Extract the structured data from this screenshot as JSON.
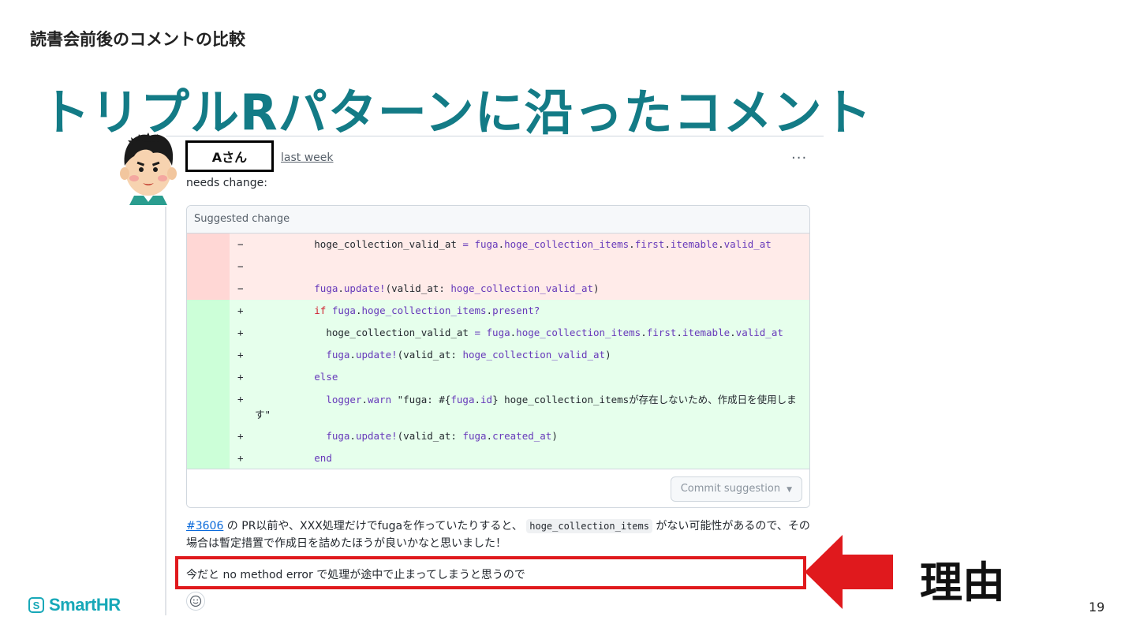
{
  "slide": {
    "subtitle": "読書会前後のコメントの比較",
    "title": "トリプルRパターンに沿ったコメント",
    "page_number": "19",
    "logo_text": "SmartHR",
    "logo_mark": "S",
    "reason_label": "理由",
    "accent_color": "#137b86",
    "highlight_color": "#e0191d"
  },
  "comment": {
    "author": "Aさん",
    "timestamp": "last week",
    "more_label": "···",
    "label": "needs change:",
    "suggestion": {
      "header": "Suggested change",
      "deleted": [
        {
          "marker": "−",
          "indent": "          ",
          "parts": [
            [
              "t",
              "hoge_collection_valid_at "
            ],
            [
              "m",
              "="
            ],
            [
              "t",
              " "
            ],
            [
              "m",
              "fuga"
            ],
            [
              "t",
              "."
            ],
            [
              "m",
              "hoge_collection_items"
            ],
            [
              "t",
              "."
            ],
            [
              "m",
              "first"
            ],
            [
              "t",
              "."
            ],
            [
              "m",
              "itemable"
            ],
            [
              "t",
              "."
            ],
            [
              "m",
              "valid_at"
            ]
          ]
        },
        {
          "marker": "−",
          "indent": "",
          "parts": []
        },
        {
          "marker": "−",
          "indent": "          ",
          "parts": [
            [
              "m",
              "fuga"
            ],
            [
              "t",
              "."
            ],
            [
              "m",
              "update!"
            ],
            [
              "t",
              "(valid_at: "
            ],
            [
              "m",
              "hoge_collection_valid_at"
            ],
            [
              "t",
              ")"
            ]
          ]
        }
      ],
      "added": [
        {
          "marker": "+",
          "indent": "          ",
          "parts": [
            [
              "k",
              "if"
            ],
            [
              "t",
              " "
            ],
            [
              "m",
              "fuga"
            ],
            [
              "t",
              "."
            ],
            [
              "m",
              "hoge_collection_items"
            ],
            [
              "t",
              "."
            ],
            [
              "m",
              "present?"
            ]
          ]
        },
        {
          "marker": "+",
          "indent": "            ",
          "parts": [
            [
              "t",
              "hoge_collection_valid_at "
            ],
            [
              "m",
              "="
            ],
            [
              "t",
              " "
            ],
            [
              "m",
              "fuga"
            ],
            [
              "t",
              "."
            ],
            [
              "m",
              "hoge_collection_items"
            ],
            [
              "t",
              "."
            ],
            [
              "m",
              "first"
            ],
            [
              "t",
              "."
            ],
            [
              "m",
              "itemable"
            ],
            [
              "t",
              "."
            ],
            [
              "m",
              "valid_at"
            ]
          ]
        },
        {
          "marker": "+",
          "indent": "            ",
          "parts": [
            [
              "m",
              "fuga"
            ],
            [
              "t",
              "."
            ],
            [
              "m",
              "update!"
            ],
            [
              "t",
              "(valid_at: "
            ],
            [
              "m",
              "hoge_collection_valid_at"
            ],
            [
              "t",
              ")"
            ]
          ]
        },
        {
          "marker": "+",
          "indent": "          ",
          "parts": [
            [
              "m",
              "else"
            ]
          ]
        },
        {
          "marker": "+",
          "indent": "            ",
          "wrap": true,
          "parts": [
            [
              "m",
              "logger"
            ],
            [
              "t",
              "."
            ],
            [
              "m",
              "warn"
            ],
            [
              "t",
              " \"fuga: #{"
            ],
            [
              "m",
              "fuga"
            ],
            [
              "t",
              "."
            ],
            [
              "m",
              "id"
            ],
            [
              "t",
              "} hoge_collection_itemsが存在しないため、作成日を使用します\""
            ]
          ]
        },
        {
          "marker": "+",
          "indent": "            ",
          "parts": [
            [
              "m",
              "fuga"
            ],
            [
              "t",
              "."
            ],
            [
              "m",
              "update!"
            ],
            [
              "t",
              "(valid_at: "
            ],
            [
              "m",
              "fuga"
            ],
            [
              "t",
              "."
            ],
            [
              "m",
              "created_at"
            ],
            [
              "t",
              ")"
            ]
          ]
        },
        {
          "marker": "+",
          "indent": "          ",
          "parts": [
            [
              "m",
              "end"
            ]
          ]
        }
      ],
      "commit_button": "Commit suggestion"
    },
    "body": {
      "issue_ref": "#3606",
      "text_a": " の PR以前や、XXX処理だけでfugaを作っていたりすると、 ",
      "inline_code": "hoge_collection_items",
      "text_b": " がない可能性があるので、その場合は暫定措置で作成日を詰めたほうが良いかなと思いました！"
    },
    "highlighted_reason": "今だと no method error で処理が途中で止まってしまうと思うので"
  },
  "icons": {
    "avatar": "avatar-icon",
    "arrow": "left-arrow-icon",
    "emoji": "smiley-icon",
    "caret": "caret-down-icon"
  }
}
